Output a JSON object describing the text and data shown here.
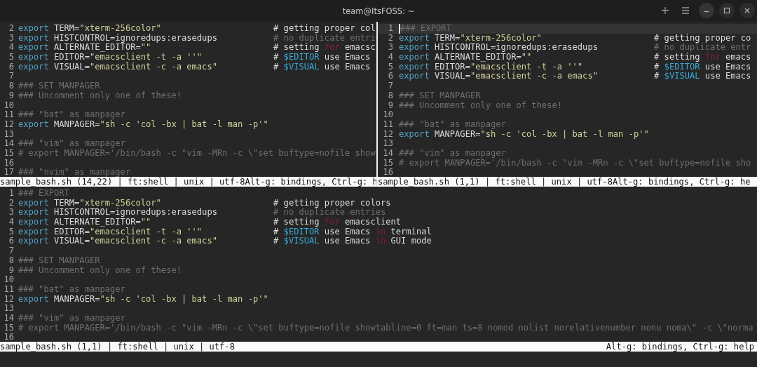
{
  "window": {
    "title": "team@ItsFOSS: ~"
  },
  "panes": [
    {
      "kind": "half",
      "lines": [
        {
          "n": "2",
          "code": [
            {
              "kind": "kw",
              "text": "export"
            },
            {
              "kind": "text",
              "text": " TERM="
            },
            {
              "kind": "str",
              "text": "\"xterm-256color\""
            }
          ],
          "note": [
            {
              "kind": "text",
              "text": "# getting proper col"
            }
          ]
        },
        {
          "n": "3",
          "code": [
            {
              "kind": "kw",
              "text": "export"
            },
            {
              "kind": "text",
              "text": " HISTCONTROL=ignoredups:erasedups"
            }
          ],
          "note": [
            {
              "kind": "cmt",
              "text": "# no duplicate entri"
            }
          ]
        },
        {
          "n": "4",
          "code": [
            {
              "kind": "kw",
              "text": "export"
            },
            {
              "kind": "text",
              "text": " ALTERNATE_EDITOR="
            },
            {
              "kind": "str",
              "text": "\"\""
            }
          ],
          "note": [
            {
              "kind": "text",
              "text": "# setting "
            },
            {
              "kind": "flow",
              "text": "for"
            },
            {
              "kind": "text",
              "text": " emacsc"
            }
          ]
        },
        {
          "n": "5",
          "code": [
            {
              "kind": "kw",
              "text": "export"
            },
            {
              "kind": "text",
              "text": " EDITOR="
            },
            {
              "kind": "str",
              "text": "\"emacsclient -t -a ''\""
            }
          ],
          "note": [
            {
              "kind": "text",
              "text": "# "
            },
            {
              "kind": "var",
              "text": "$EDITOR"
            },
            {
              "kind": "text",
              "text": " use Emacs"
            }
          ]
        },
        {
          "n": "6",
          "code": [
            {
              "kind": "kw",
              "text": "export"
            },
            {
              "kind": "text",
              "text": " VISUAL="
            },
            {
              "kind": "str",
              "text": "\"emacsclient -c -a emacs\""
            }
          ],
          "note": [
            {
              "kind": "text",
              "text": "# "
            },
            {
              "kind": "var",
              "text": "$VISUAL"
            },
            {
              "kind": "text",
              "text": " use Emacs"
            }
          ]
        },
        {
          "n": "7"
        },
        {
          "n": "8",
          "code": [
            {
              "kind": "cmt",
              "text": "### SET MANPAGER"
            }
          ]
        },
        {
          "n": "9",
          "code": [
            {
              "kind": "cmt",
              "text": "### Uncomment only one of these!"
            }
          ]
        },
        {
          "n": "10"
        },
        {
          "n": "11",
          "code": [
            {
              "kind": "cmt",
              "text": "### \"bat\" as manpager"
            }
          ]
        },
        {
          "n": "12",
          "code": [
            {
              "kind": "kw",
              "text": "export"
            },
            {
              "kind": "text",
              "text": " MANPAGER="
            },
            {
              "kind": "str",
              "text": "\"sh -c 'col -bx | bat -l man -p'\""
            }
          ]
        },
        {
          "n": "13"
        },
        {
          "n": "14",
          "code": [
            {
              "kind": "cmt",
              "text": "### \"vim\" as manpager"
            }
          ]
        },
        {
          "n": "15",
          "code": [
            {
              "kind": "cmt",
              "text": "# export MANPAGER='/bin/bash -c \"vim -MRn -c \\\"set buftype=nofile show"
            }
          ]
        },
        {
          "n": "16"
        },
        {
          "n": "17",
          "code": [
            {
              "kind": "cmt",
              "text": "### \"nvim\" as manpager"
            }
          ]
        }
      ],
      "status_left": "sample_bash.sh (14,22) | ft:shell | unix | utf-8",
      "status_right": "Alt-g: bindings, Ctrl-g: h"
    },
    {
      "kind": "half",
      "lines": [
        {
          "n": "1",
          "current": true,
          "code": [
            {
              "kind": "cmt",
              "text": "### EXPORT"
            }
          ]
        },
        {
          "n": "2",
          "current": false,
          "code": [
            {
              "kind": "kw",
              "text": "export"
            },
            {
              "kind": "text",
              "text": " TERM="
            },
            {
              "kind": "str",
              "text": "\"xterm-256color\""
            }
          ],
          "note": [
            {
              "kind": "text",
              "text": "# getting proper co"
            }
          ]
        },
        {
          "n": "3",
          "current": false,
          "code": [
            {
              "kind": "kw",
              "text": "export"
            },
            {
              "kind": "text",
              "text": " HISTCONTROL=ignoredups:erasedups"
            }
          ],
          "note": [
            {
              "kind": "cmt",
              "text": "# no duplicate entr"
            }
          ]
        },
        {
          "n": "4",
          "current": false,
          "code": [
            {
              "kind": "kw",
              "text": "export"
            },
            {
              "kind": "text",
              "text": " ALTERNATE_EDITOR="
            },
            {
              "kind": "str",
              "text": "\"\""
            }
          ],
          "note": [
            {
              "kind": "text",
              "text": "# setting "
            },
            {
              "kind": "flow",
              "text": "for"
            },
            {
              "kind": "text",
              "text": " emacs"
            }
          ]
        },
        {
          "n": "5",
          "current": false,
          "code": [
            {
              "kind": "kw",
              "text": "export"
            },
            {
              "kind": "text",
              "text": " EDITOR="
            },
            {
              "kind": "str",
              "text": "\"emacsclient -t -a ''\""
            }
          ],
          "note": [
            {
              "kind": "text",
              "text": "# "
            },
            {
              "kind": "var",
              "text": "$EDITOR"
            },
            {
              "kind": "text",
              "text": " use Emacs"
            }
          ]
        },
        {
          "n": "6",
          "current": false,
          "code": [
            {
              "kind": "kw",
              "text": "export"
            },
            {
              "kind": "text",
              "text": " VISUAL="
            },
            {
              "kind": "str",
              "text": "\"emacsclient -c -a emacs\""
            }
          ],
          "note": [
            {
              "kind": "text",
              "text": "# "
            },
            {
              "kind": "var",
              "text": "$VISUAL"
            },
            {
              "kind": "text",
              "text": " use Emacs"
            }
          ]
        },
        {
          "n": "7",
          "current": false
        },
        {
          "n": "8",
          "current": false,
          "code": [
            {
              "kind": "cmt",
              "text": "### SET MANPAGER"
            }
          ]
        },
        {
          "n": "9",
          "current": false,
          "code": [
            {
              "kind": "cmt",
              "text": "### Uncomment only one of these!"
            }
          ]
        },
        {
          "n": "10",
          "current": false
        },
        {
          "n": "11",
          "current": false,
          "code": [
            {
              "kind": "cmt",
              "text": "### \"bat\" as manpager"
            }
          ]
        },
        {
          "n": "12",
          "current": false,
          "code": [
            {
              "kind": "kw",
              "text": "export"
            },
            {
              "kind": "text",
              "text": " MANPAGER="
            },
            {
              "kind": "str",
              "text": "\"sh -c 'col -bx | bat -l man -p'\""
            }
          ]
        },
        {
          "n": "13",
          "current": false
        },
        {
          "n": "14",
          "current": false,
          "code": [
            {
              "kind": "cmt",
              "text": "### \"vim\" as manpager"
            }
          ]
        },
        {
          "n": "15",
          "current": false,
          "code": [
            {
              "kind": "cmt",
              "text": "# export MANPAGER='/bin/bash -c \"vim -MRn -c \\\"set buftype=nofile sho"
            }
          ]
        },
        {
          "n": "16",
          "current": false
        }
      ],
      "status_left": "sample_bash.sh (1,1) | ft:shell | unix | utf-8",
      "status_right": "Alt-g: bindings, Ctrl-g: he"
    },
    {
      "kind": "full",
      "lines": [
        {
          "n": "1",
          "code": [
            {
              "kind": "cmt",
              "text": "### EXPORT"
            }
          ]
        },
        {
          "n": "2",
          "code": [
            {
              "kind": "kw",
              "text": "export"
            },
            {
              "kind": "text",
              "text": " TERM="
            },
            {
              "kind": "str",
              "text": "\"xterm-256color\""
            }
          ],
          "note": [
            {
              "kind": "text",
              "text": "# getting proper colors"
            }
          ]
        },
        {
          "n": "3",
          "code": [
            {
              "kind": "kw",
              "text": "export"
            },
            {
              "kind": "text",
              "text": " HISTCONTROL=ignoredups:erasedups"
            }
          ],
          "note": [
            {
              "kind": "cmt",
              "text": "# no duplicate entries"
            }
          ]
        },
        {
          "n": "4",
          "code": [
            {
              "kind": "kw",
              "text": "export"
            },
            {
              "kind": "text",
              "text": " ALTERNATE_EDITOR="
            },
            {
              "kind": "str",
              "text": "\"\""
            }
          ],
          "note": [
            {
              "kind": "text",
              "text": "# setting "
            },
            {
              "kind": "flow",
              "text": "for"
            },
            {
              "kind": "text",
              "text": " emacsclient"
            }
          ]
        },
        {
          "n": "5",
          "code": [
            {
              "kind": "kw",
              "text": "export"
            },
            {
              "kind": "text",
              "text": " EDITOR="
            },
            {
              "kind": "str",
              "text": "\"emacsclient -t -a ''\""
            }
          ],
          "note": [
            {
              "kind": "text",
              "text": "# "
            },
            {
              "kind": "var",
              "text": "$EDITOR"
            },
            {
              "kind": "text",
              "text": " use Emacs "
            },
            {
              "kind": "flow",
              "text": "in"
            },
            {
              "kind": "text",
              "text": " terminal"
            }
          ]
        },
        {
          "n": "6",
          "code": [
            {
              "kind": "kw",
              "text": "export"
            },
            {
              "kind": "text",
              "text": " VISUAL="
            },
            {
              "kind": "str",
              "text": "\"emacsclient -c -a emacs\""
            }
          ],
          "note": [
            {
              "kind": "text",
              "text": "# "
            },
            {
              "kind": "var",
              "text": "$VISUAL"
            },
            {
              "kind": "text",
              "text": " use Emacs "
            },
            {
              "kind": "flow",
              "text": "in"
            },
            {
              "kind": "text",
              "text": " GUI mode"
            }
          ]
        },
        {
          "n": "7"
        },
        {
          "n": "8",
          "code": [
            {
              "kind": "cmt",
              "text": "### SET MANPAGER"
            }
          ]
        },
        {
          "n": "9",
          "code": [
            {
              "kind": "cmt",
              "text": "### Uncomment only one of these!"
            }
          ]
        },
        {
          "n": "10"
        },
        {
          "n": "11",
          "code": [
            {
              "kind": "cmt",
              "text": "### \"bat\" as manpager"
            }
          ]
        },
        {
          "n": "12",
          "code": [
            {
              "kind": "kw",
              "text": "export"
            },
            {
              "kind": "text",
              "text": " MANPAGER="
            },
            {
              "kind": "str",
              "text": "\"sh -c 'col -bx | bat -l man -p'\""
            }
          ]
        },
        {
          "n": "13"
        },
        {
          "n": "14",
          "code": [
            {
              "kind": "cmt",
              "text": "### \"vim\" as manpager"
            }
          ]
        },
        {
          "n": "15",
          "code": [
            {
              "kind": "cmt",
              "text": "# export MANPAGER='/bin/bash -c \"vim -MRn -c \\\"set buftype=nofile showtabline=0 ft=man ts=8 nomod nolist norelativenumber nonu noma\\\" -c \\\"norma"
            }
          ]
        },
        {
          "n": "16"
        }
      ],
      "status_left": "sample_bash.sh (1,1) | ft:shell | unix | utf-8",
      "status_right": "Alt-g: bindings, Ctrl-g: help"
    }
  ]
}
